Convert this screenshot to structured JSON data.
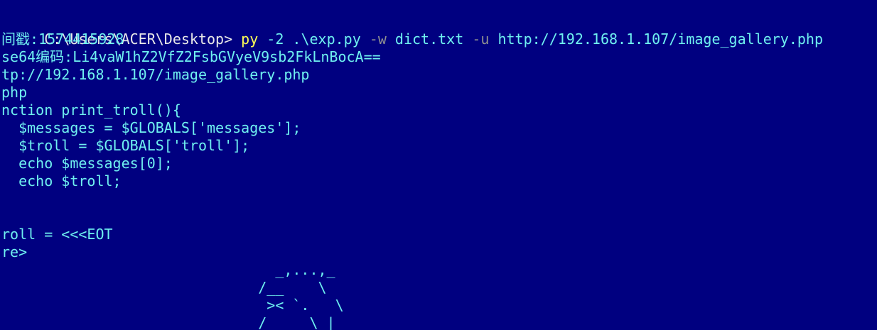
{
  "colors": {
    "background": "#000080",
    "text": "#6ff0f0",
    "prompt": "#e8e8e8",
    "command": "#ffff55",
    "flag": "#8f9090"
  },
  "prompt": " C:\\Users\\ACER\\Desktop> ",
  "command": {
    "exe": "py",
    "version": " -2",
    "script": " .\\exp.py ",
    "flag_w": "-w",
    "dict": " dict.txt ",
    "flag_u": "-u",
    "url": " http://192.168.1.107/image_gallery.php"
  },
  "output": [
    "间戳:1574415928",
    "se64编码:Li4vaW1hZ2VfZ2FsbGVyeV9sb2FkLnBocA==",
    "tp://192.168.1.107/image_gallery.php",
    "php",
    "nction print_troll(){",
    "  $messages = $GLOBALS['messages'];",
    "  $troll = $GLOBALS['troll'];",
    "  echo $messages[0];",
    "  echo $troll;",
    "roll = <<<EOT",
    "re>"
  ],
  "ascii_art": [
    "                                _,...,_",
    "                              /__    \\",
    "                               >< `.   \\",
    "                              /     \\ |"
  ]
}
